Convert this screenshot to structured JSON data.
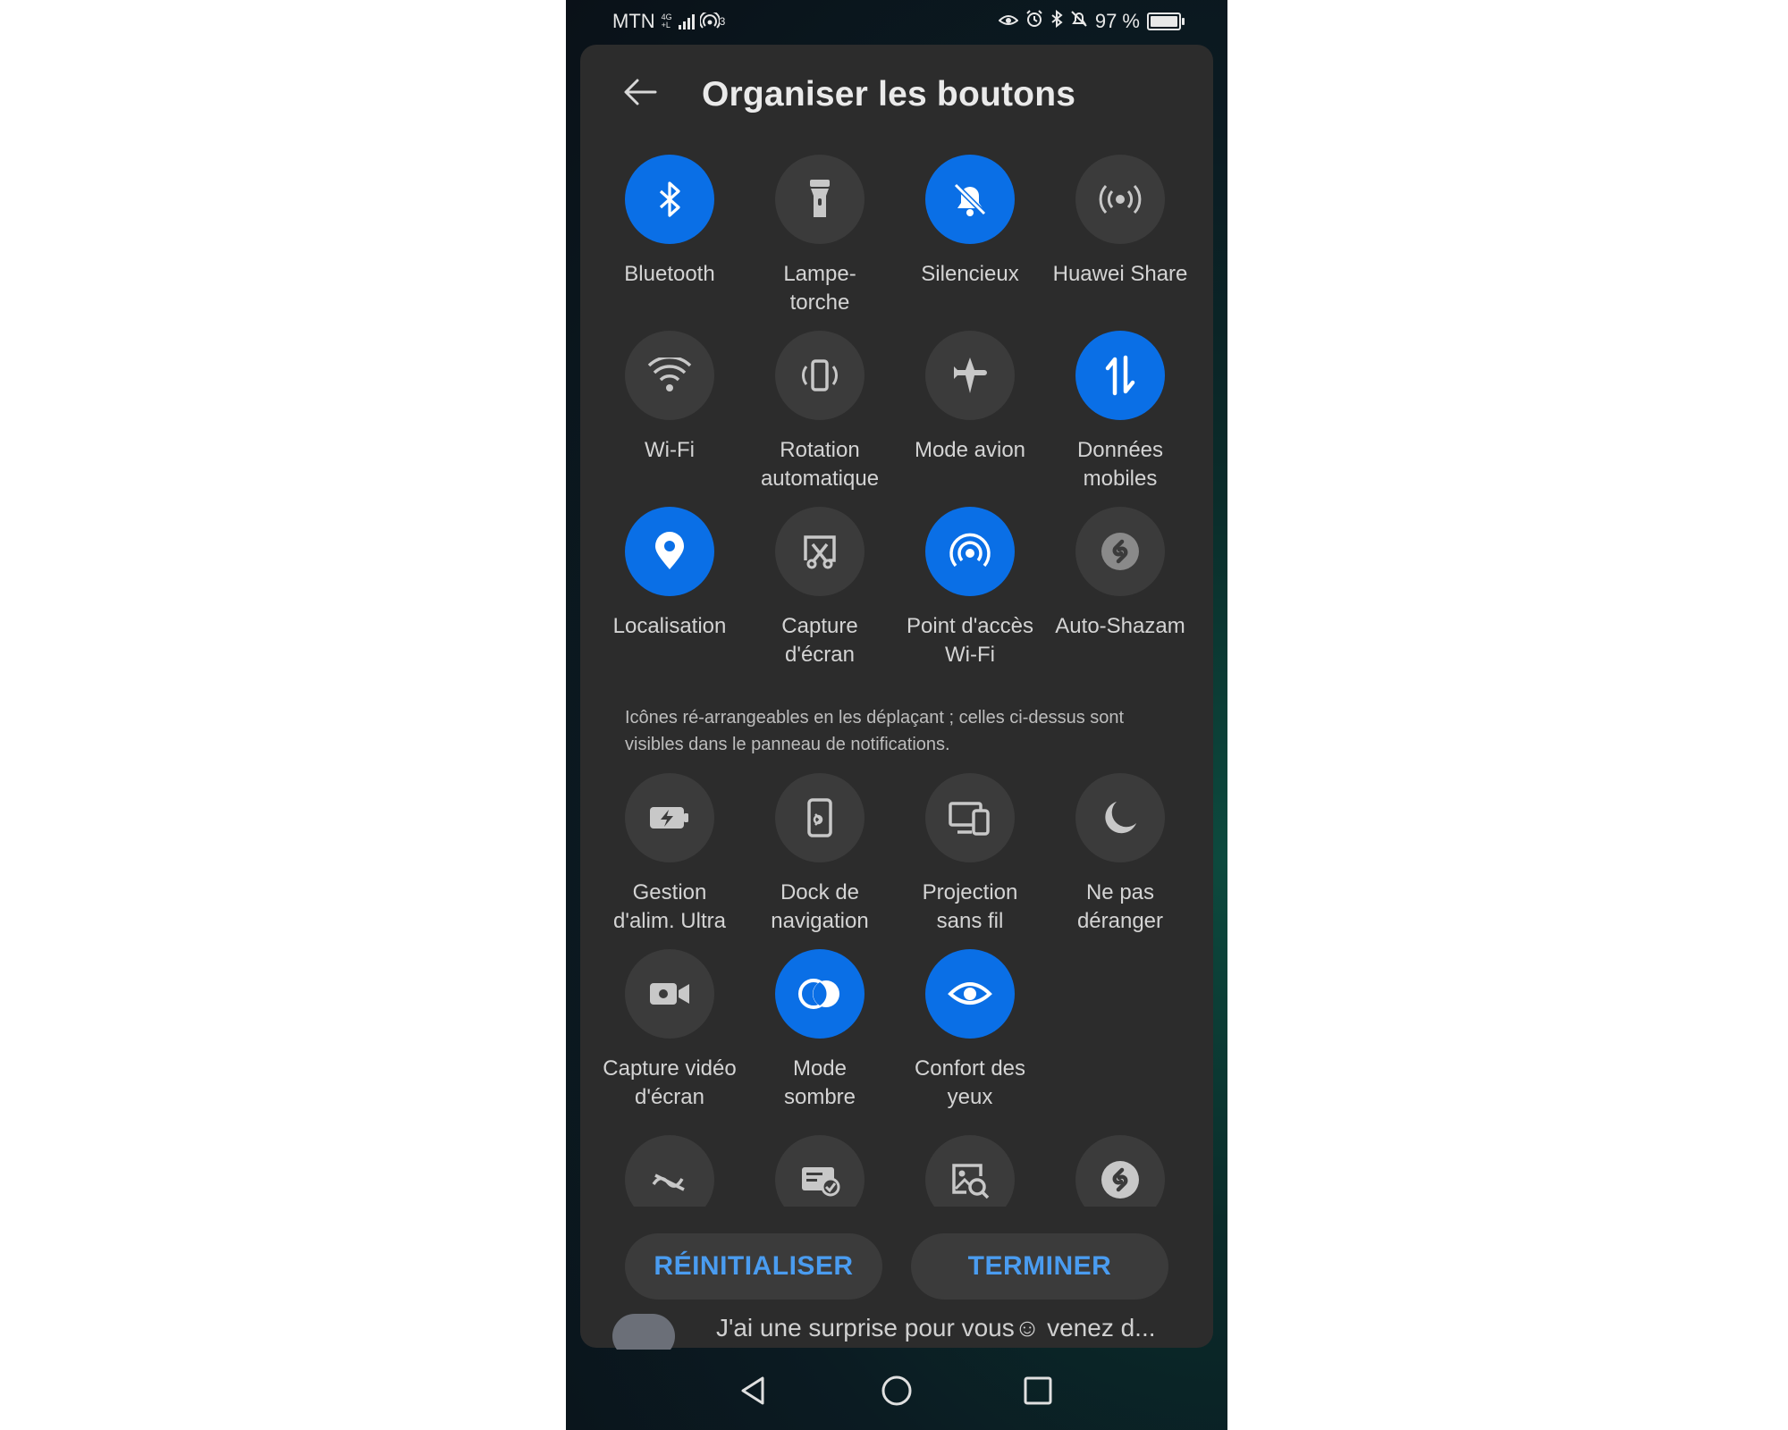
{
  "status_bar": {
    "carrier": "MTN",
    "network_top": "4G",
    "network_bottom": "+L",
    "hotspot_count": "3",
    "battery": "97 %"
  },
  "header": {
    "title": "Organiser les boutons",
    "back_icon": "back-arrow-icon"
  },
  "active_tiles": [
    {
      "label": "Bluetooth",
      "icon": "bluetooth-icon",
      "on": true
    },
    {
      "label": "Lampe-\ntorche",
      "icon": "flashlight-icon",
      "on": false
    },
    {
      "label": "Silencieux",
      "icon": "bell-off-icon",
      "on": true
    },
    {
      "label": "Huawei Share",
      "icon": "huawei-share-icon",
      "on": false
    },
    {
      "label": "Wi-Fi",
      "icon": "wifi-icon",
      "on": false
    },
    {
      "label": "Rotation\nautomatique",
      "icon": "auto-rotate-icon",
      "on": false
    },
    {
      "label": "Mode avion",
      "icon": "airplane-icon",
      "on": false
    },
    {
      "label": "Données\nmobiles",
      "icon": "mobile-data-icon",
      "on": true
    },
    {
      "label": "Localisation",
      "icon": "location-pin-icon",
      "on": true
    },
    {
      "label": "Capture\nd'écran",
      "icon": "screenshot-icon",
      "on": false
    },
    {
      "label": "Point d'accès\nWi-Fi",
      "icon": "hotspot-icon",
      "on": true
    },
    {
      "label": "Auto-Shazam",
      "icon": "shazam-icon",
      "on": false
    }
  ],
  "hint": "Icônes ré-arrangeables en les déplaçant ; celles ci-dessus sont visibles dans le panneau de notifications.",
  "available_tiles": [
    {
      "label": "Gestion\nd'alim. Ultra",
      "icon": "battery-saver-icon",
      "on": false
    },
    {
      "label": "Dock de\nnavigation",
      "icon": "navigation-dock-icon",
      "on": false
    },
    {
      "label": "Projection\nsans fil",
      "icon": "wireless-projection-icon",
      "on": false
    },
    {
      "label": "Ne pas\ndéranger",
      "icon": "moon-icon",
      "on": false
    },
    {
      "label": "Capture vidéo\nd'écran",
      "icon": "screen-recorder-icon",
      "on": false
    },
    {
      "label": "Mode\nsombre",
      "icon": "dark-mode-icon",
      "on": true
    },
    {
      "label": "Confort des\nyeux",
      "icon": "eye-comfort-icon",
      "on": true
    }
  ],
  "partial_tiles": [
    {
      "icon": "wave-icon"
    },
    {
      "icon": "card-check-icon"
    },
    {
      "icon": "image-search-icon"
    },
    {
      "icon": "shazam-icon"
    }
  ],
  "buttons": {
    "reset": "RÉINITIALISER",
    "done": "TERMINER"
  },
  "notification_peek": "J'ai une surprise pour vous☺ venez d...",
  "colors": {
    "accent": "#0a6fe6",
    "tile_off": "#3b3b3b",
    "panel": "#2c2c2c",
    "button_text": "#4a9cf0"
  }
}
